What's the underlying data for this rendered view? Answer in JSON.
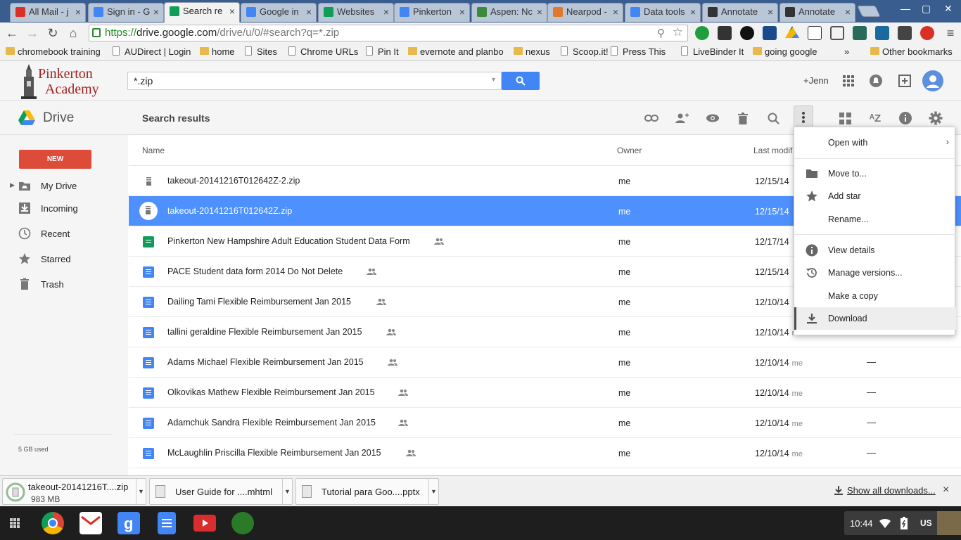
{
  "browser": {
    "tabs": [
      {
        "title": "All Mail - j",
        "favicon": "gmail-icon",
        "color": "#d93025"
      },
      {
        "title": "Sign in - G",
        "favicon": "google-icon",
        "color": "#4285f4"
      },
      {
        "title": "Search re",
        "favicon": "drive-icon",
        "color": "#0f9d58"
      },
      {
        "title": "Google in",
        "favicon": "docs-icon",
        "color": "#4285f4"
      },
      {
        "title": "Websites",
        "favicon": "sheets-icon",
        "color": "#0f9d58"
      },
      {
        "title": "Pinkerton",
        "favicon": "calendar-icon",
        "color": "#4285f4"
      },
      {
        "title": "Aspen: Nc",
        "favicon": "leaf-icon",
        "color": "#3a8a3a"
      },
      {
        "title": "Nearpod -",
        "favicon": "nearpod-icon",
        "color": "#e07a2a"
      },
      {
        "title": "Data tools",
        "favicon": "google-icon",
        "color": "#4285f4"
      },
      {
        "title": "Annotate",
        "favicon": "annotate-icon",
        "color": "#333333"
      },
      {
        "title": "Annotate",
        "favicon": "annotate-icon",
        "color": "#333333"
      }
    ],
    "active_tab": 2,
    "url_scheme": "https://",
    "url_host": "drive.google.com",
    "url_rest": "/drive/u/0/#search?q=*.zip",
    "bookmarks": [
      "chromebook training",
      "AUDirect | Login",
      "home",
      "Sites",
      "Chrome URLs",
      "Pin It",
      "evernote and planbo",
      "nexus",
      "Scoop.it!",
      "Press This",
      "LiveBinder It",
      "going google"
    ],
    "bookmarks_more": "»",
    "other_bookmarks": "Other bookmarks"
  },
  "header": {
    "logo_line1": "Pinkerton",
    "logo_line2": "Academy",
    "search_value": "*.zip",
    "user": "+Jenn"
  },
  "drive": {
    "app_name": "Drive",
    "view_title": "Search results",
    "new_button": "NEW",
    "sidebar": [
      {
        "label": "My Drive",
        "icon": "my-drive-icon"
      },
      {
        "label": "Incoming",
        "icon": "incoming-icon"
      },
      {
        "label": "Recent",
        "icon": "clock-icon"
      },
      {
        "label": "Starred",
        "icon": "star-icon"
      },
      {
        "label": "Trash",
        "icon": "trash-icon"
      }
    ],
    "quota": "5 GB used",
    "columns": {
      "name": "Name",
      "owner": "Owner",
      "modified": "Last modif"
    },
    "files": [
      {
        "name": "takeout-20141216T012642Z-2.zip",
        "type": "zip",
        "owner": "me",
        "modified": "12/15/14",
        "modified_by": "",
        "size": "",
        "shared": false,
        "selected": false
      },
      {
        "name": "takeout-20141216T012642Z.zip",
        "type": "zip",
        "owner": "me",
        "modified": "12/15/14",
        "modified_by": "",
        "size": "",
        "shared": false,
        "selected": true
      },
      {
        "name": "Pinkerton New Hampshire Adult Education Student Data Form",
        "type": "sheet",
        "owner": "me",
        "modified": "12/17/14",
        "modified_by": "",
        "size": "",
        "shared": true,
        "selected": false
      },
      {
        "name": "PACE Student data form 2014 Do Not Delete",
        "type": "doc",
        "owner": "me",
        "modified": "12/15/14",
        "modified_by": "",
        "size": "",
        "shared": true,
        "selected": false
      },
      {
        "name": "Dailing Tami Flexible Reimbursement Jan 2015",
        "type": "doc",
        "owner": "me",
        "modified": "12/10/14",
        "modified_by": "",
        "size": "",
        "shared": true,
        "selected": false
      },
      {
        "name": "tallini geraldine Flexible Reimbursement Jan 2015",
        "type": "doc",
        "owner": "me",
        "modified": "12/10/14",
        "modified_by": "me",
        "size": "",
        "shared": true,
        "selected": false
      },
      {
        "name": "Adams Michael Flexible Reimbursement Jan 2015",
        "type": "doc",
        "owner": "me",
        "modified": "12/10/14",
        "modified_by": "me",
        "size": "—",
        "shared": true,
        "selected": false
      },
      {
        "name": "Olkovikas Mathew Flexible Reimbursement Jan 2015",
        "type": "doc",
        "owner": "me",
        "modified": "12/10/14",
        "modified_by": "me",
        "size": "—",
        "shared": true,
        "selected": false
      },
      {
        "name": "Adamchuk Sandra Flexible Reimbursement Jan 2015",
        "type": "doc",
        "owner": "me",
        "modified": "12/10/14",
        "modified_by": "me",
        "size": "—",
        "shared": true,
        "selected": false
      },
      {
        "name": "McLaughlin Priscilla Flexible Reimbursement Jan 2015",
        "type": "doc",
        "owner": "me",
        "modified": "12/10/14",
        "modified_by": "me",
        "size": "—",
        "shared": true,
        "selected": false
      }
    ],
    "context_menu": [
      {
        "label": "Open with",
        "icon": "",
        "submenu": true
      },
      {
        "label": "Move to...",
        "icon": "folder-icon"
      },
      {
        "label": "Add star",
        "icon": "star-icon"
      },
      {
        "label": "Rename...",
        "icon": ""
      },
      {
        "label": "View details",
        "icon": "info-icon"
      },
      {
        "label": "Manage versions...",
        "icon": "history-icon"
      },
      {
        "label": "Make a copy",
        "icon": ""
      },
      {
        "label": "Download",
        "icon": "download-icon"
      }
    ]
  },
  "downloads": {
    "items": [
      {
        "name": "takeout-20141216T....zip",
        "size": "983 MB"
      },
      {
        "name": "User Guide for ....mhtml",
        "size": ""
      },
      {
        "name": "Tutorial para Goo....pptx",
        "size": ""
      }
    ],
    "show_all": "Show all downloads...",
    "close": "×"
  },
  "system": {
    "clock": "10:44",
    "language": "US"
  },
  "colors": {
    "accent_blue": "#4285f4",
    "selection": "#4d90fe",
    "new_button": "#dd4b39",
    "brand_red": "#a32020"
  }
}
